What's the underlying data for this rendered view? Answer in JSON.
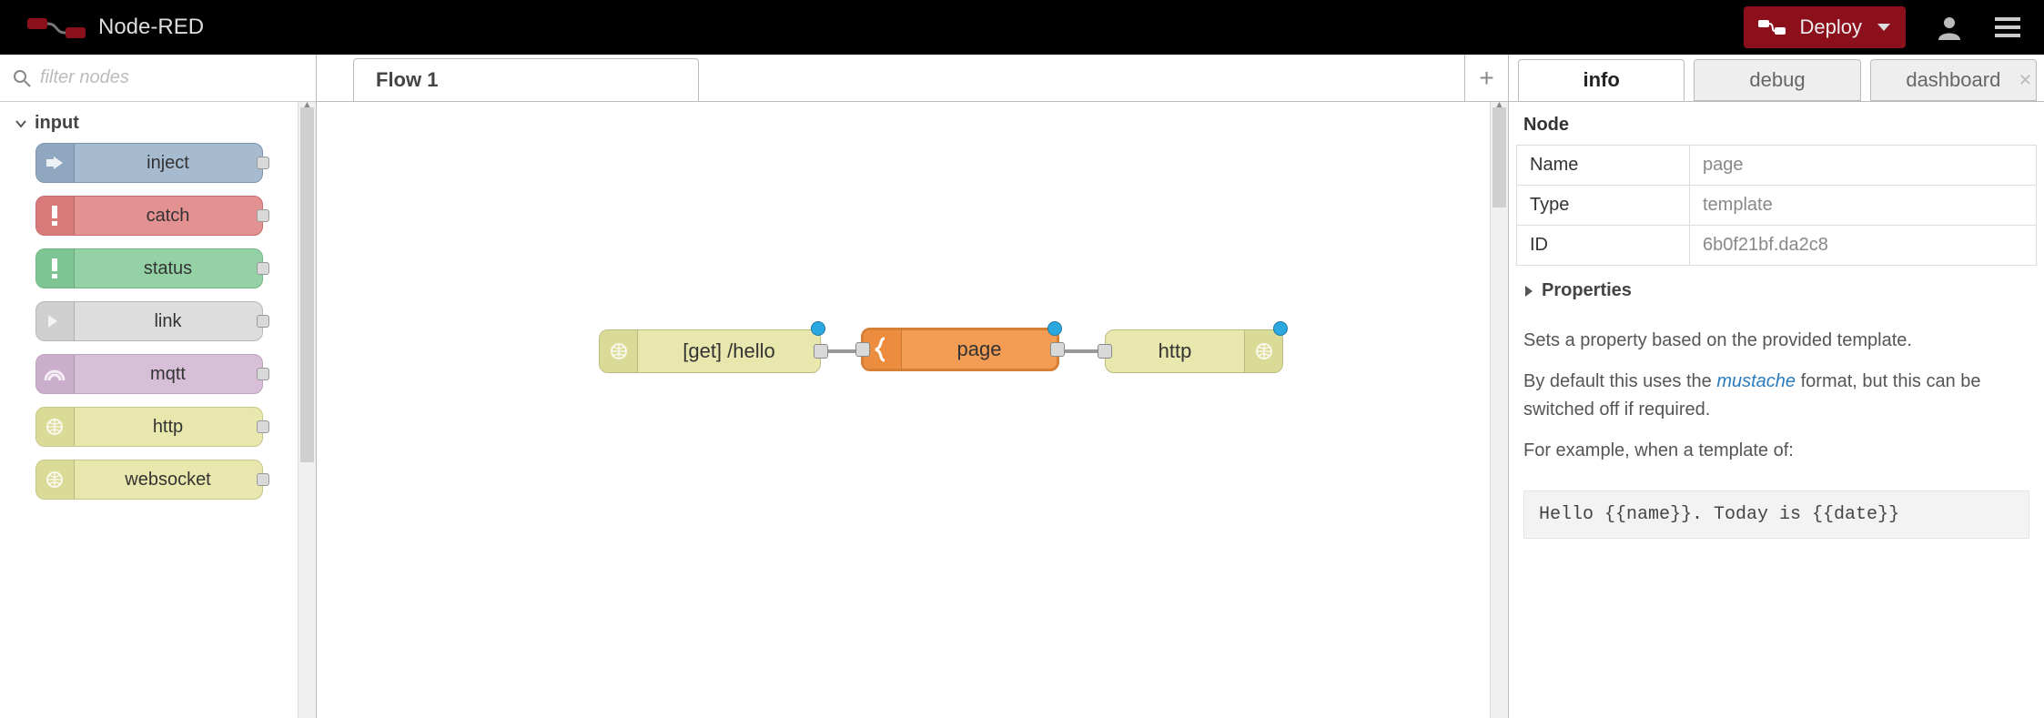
{
  "header": {
    "app_name": "Node-RED",
    "deploy_label": "Deploy"
  },
  "palette": {
    "filter_placeholder": "filter nodes",
    "category": "input",
    "nodes": {
      "inject": "inject",
      "catch": "catch",
      "status": "status",
      "link": "link",
      "mqtt": "mqtt",
      "http": "http",
      "websocket": "websocket"
    }
  },
  "workspace": {
    "tab_label": "Flow 1",
    "nodes": {
      "http_in_label": "[get] /hello",
      "template_label": "page",
      "http_out_label": "http"
    }
  },
  "sidebar": {
    "tabs": {
      "info": "info",
      "debug": "debug",
      "dashboard": "dashboard"
    },
    "section_node": "Node",
    "rows": {
      "name_key": "Name",
      "name_val": "page",
      "type_key": "Type",
      "type_val": "template",
      "id_key": "ID",
      "id_val": "6b0f21bf.da2c8"
    },
    "properties_label": "Properties",
    "desc_p1": "Sets a property based on the provided template.",
    "desc_p2a": "By default this uses the ",
    "desc_p2_link": "mustache",
    "desc_p2b": " format, but this can be switched off if required.",
    "desc_p3": "For example, when a template of:",
    "code_example": "Hello {{name}}. Today is {{date}}"
  }
}
